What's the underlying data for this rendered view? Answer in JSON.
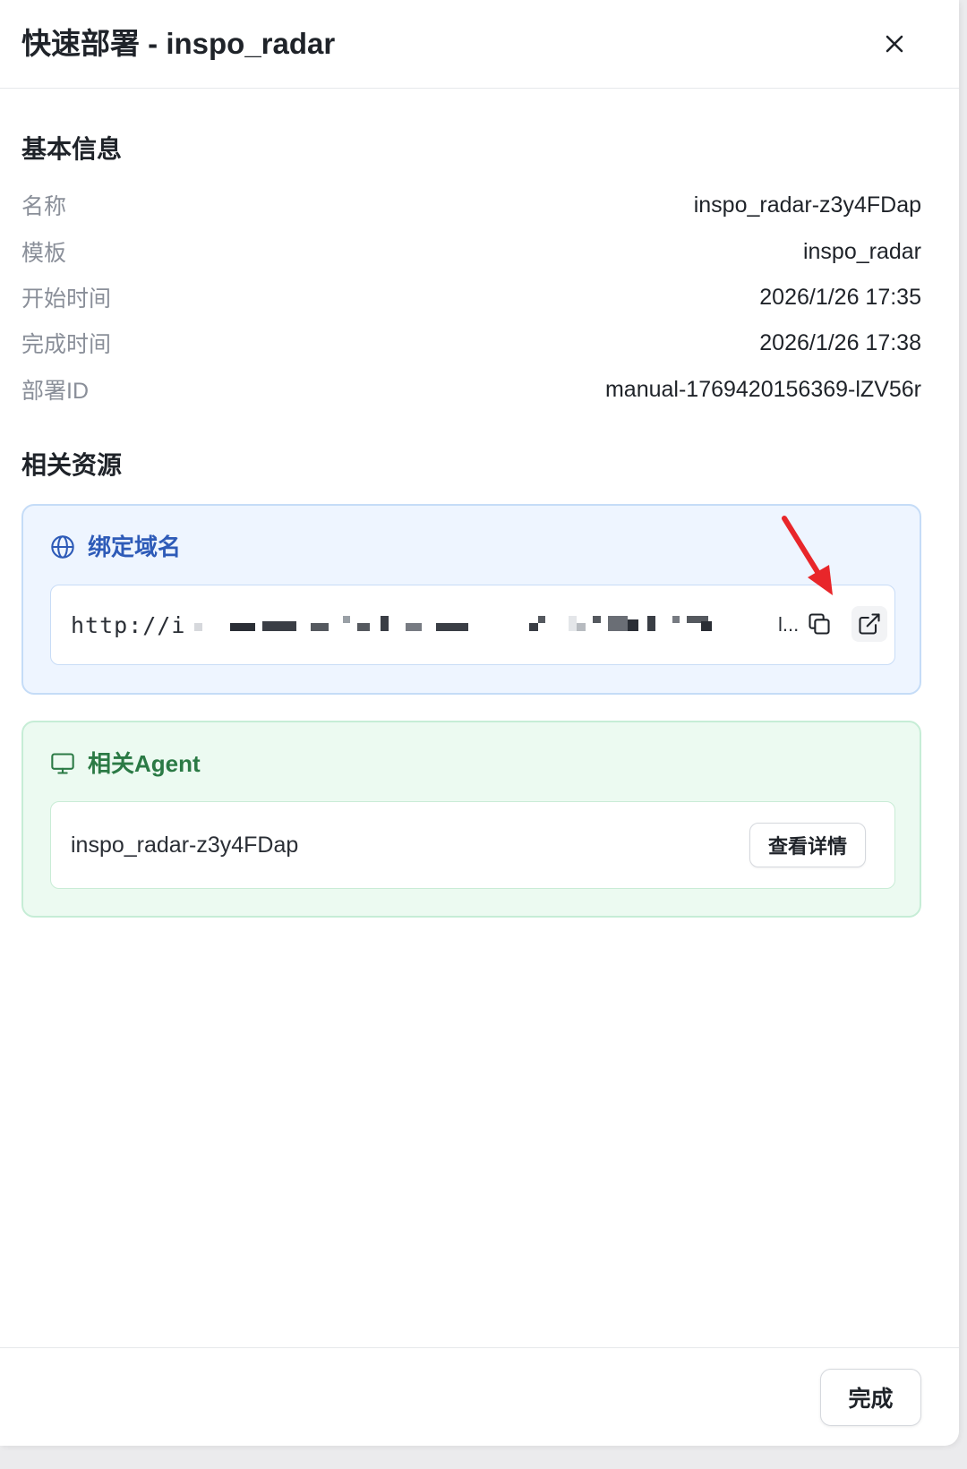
{
  "dialog": {
    "title": "快速部署 - inspo_radar",
    "close_icon": "close-icon"
  },
  "basic_info": {
    "title": "基本信息",
    "rows": [
      {
        "label": "名称",
        "value": "inspo_radar-z3y4FDap"
      },
      {
        "label": "模板",
        "value": "inspo_radar"
      },
      {
        "label": "开始时间",
        "value": "2026/1/26 17:35"
      },
      {
        "label": "完成时间",
        "value": "2026/1/26 17:38"
      },
      {
        "label": "部署ID",
        "value": "manual-1769420156369-lZV56r"
      }
    ]
  },
  "resources": {
    "title": "相关资源",
    "domain_card": {
      "title": "绑定域名",
      "icon": "globe-icon",
      "url_visible": "http://i",
      "url_ellipsis": "l...",
      "copy_icon": "copy-icon",
      "open_icon": "external-link-icon",
      "accent": "#2e5bb8"
    },
    "agent_card": {
      "title": "相关Agent",
      "icon": "monitor-icon",
      "agent_name": "inspo_radar-z3y4FDap",
      "view_label": "查看详情",
      "accent": "#2b7a45"
    }
  },
  "footer": {
    "done_label": "完成"
  },
  "annotation": {
    "arrow_color": "#e8262a"
  }
}
